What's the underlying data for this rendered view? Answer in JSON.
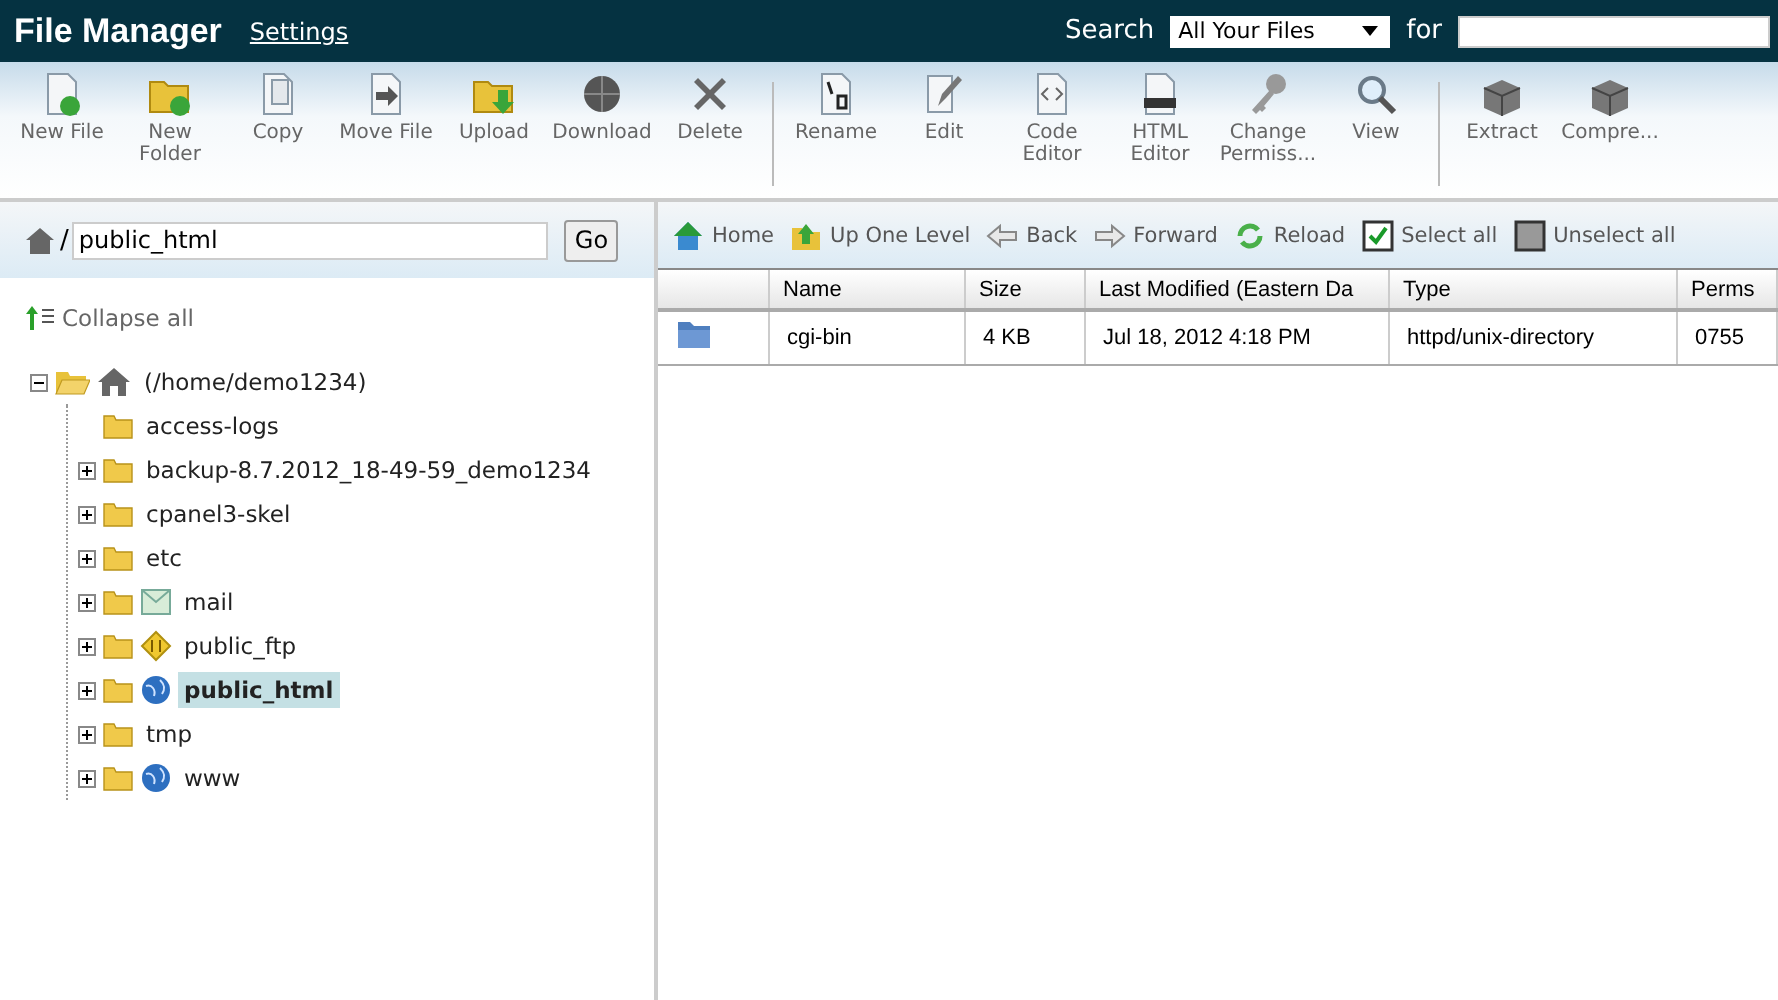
{
  "header": {
    "title": "File Manager",
    "settings_link": "Settings",
    "search_label": "Search",
    "scope": "All Your Files",
    "for_label": "for"
  },
  "toolbar_groups": [
    {
      "buttons": [
        "New File",
        "New Folder",
        "Copy",
        "Move File",
        "Upload",
        "Download",
        "Delete"
      ]
    },
    {
      "buttons": [
        "Rename",
        "Edit",
        "Code Editor",
        "HTML Editor",
        "Change Permiss...",
        "View"
      ]
    },
    {
      "buttons": [
        "Extract",
        "Compre..."
      ]
    }
  ],
  "path_bar": {
    "separator": "/",
    "value": "public_html",
    "go": "Go"
  },
  "collapse_all": "Collapse all",
  "tree": {
    "label": "(/home/demo1234)",
    "expanded": true,
    "children": [
      {
        "label": "access-logs",
        "expandable": false,
        "selected": false
      },
      {
        "label": "backup-8.7.2012_18-49-59_demo1234",
        "expandable": true,
        "expanded": false,
        "selected": false
      },
      {
        "label": "cpanel3-skel",
        "expandable": true,
        "expanded": false,
        "selected": false
      },
      {
        "label": "etc",
        "expandable": true,
        "expanded": false,
        "selected": false
      },
      {
        "label": "mail",
        "expandable": true,
        "expanded": false,
        "selected": false
      },
      {
        "label": "public_ftp",
        "expandable": true,
        "expanded": false,
        "selected": false
      },
      {
        "label": "public_html",
        "expandable": true,
        "expanded": false,
        "selected": true
      },
      {
        "label": "tmp",
        "expandable": true,
        "expanded": false,
        "selected": false
      },
      {
        "label": "www",
        "expandable": true,
        "expanded": false,
        "selected": false
      }
    ]
  },
  "nav": [
    "Home",
    "Up One Level",
    "Back",
    "Forward",
    "Reload",
    "Select all",
    "Unselect all"
  ],
  "table": {
    "columns": [
      "Name",
      "Size",
      "Last Modified (Eastern Da",
      "Type",
      "Perms"
    ],
    "rows": [
      {
        "cells": [
          "cgi-bin",
          "4 KB",
          "Jul 18, 2012 4:18 PM",
          "httpd/unix-directory",
          "0755"
        ]
      }
    ]
  }
}
